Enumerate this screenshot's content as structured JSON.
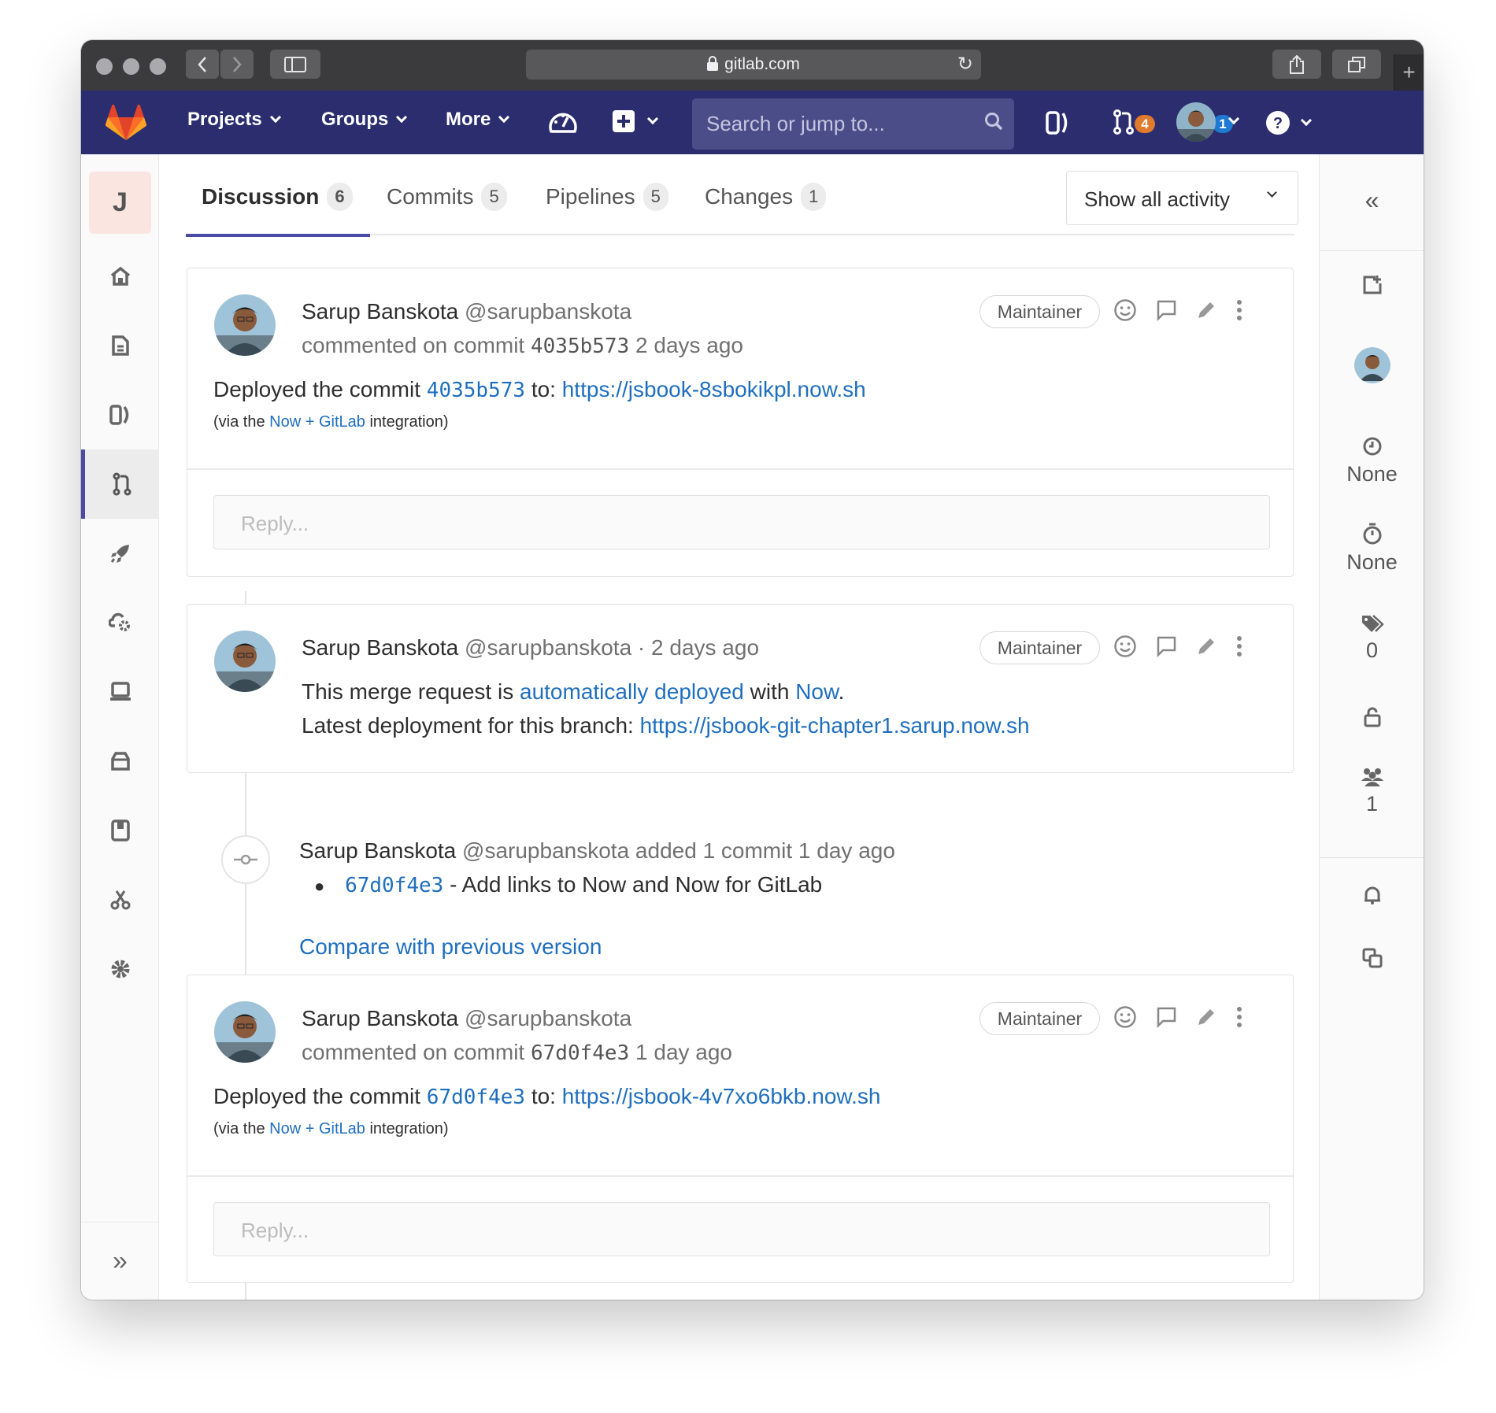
{
  "browser": {
    "url": "gitlab.com"
  },
  "navbar": {
    "projects": "Projects",
    "groups": "Groups",
    "more": "More",
    "search_placeholder": "Search or jump to...",
    "mr_count": "4",
    "todo_count": "1",
    "colors": {
      "navbar_bg": "#2b2d6e",
      "mr_badge": "#e07a2d",
      "todo_badge": "#1f78d1"
    }
  },
  "left_sidebar": {
    "project_initial": "J",
    "items": [
      {
        "icon": "home-icon"
      },
      {
        "icon": "document-icon"
      },
      {
        "icon": "issues-icon"
      },
      {
        "icon": "merge-request-icon",
        "active": true
      },
      {
        "icon": "rocket-icon"
      },
      {
        "icon": "operations-icon"
      },
      {
        "icon": "monitor-icon"
      },
      {
        "icon": "package-icon"
      },
      {
        "icon": "wiki-icon"
      },
      {
        "icon": "snippets-icon"
      },
      {
        "icon": "settings-icon"
      }
    ],
    "collapse": "»"
  },
  "tabs": [
    {
      "label": "Discussion",
      "count": "6",
      "active": true
    },
    {
      "label": "Commits",
      "count": "5"
    },
    {
      "label": "Pipelines",
      "count": "5"
    },
    {
      "label": "Changes",
      "count": "1"
    }
  ],
  "activity_filter": "Show all activity",
  "notes": [
    {
      "author": "Sarup Banskota",
      "handle": "@sarupbanskota",
      "meta_prefix": "commented on commit",
      "commit": "4035b573",
      "time": "2 days ago",
      "role": "Maintainer",
      "body_prefix": "Deployed the commit",
      "body_commit": "4035b573",
      "body_to": "to:",
      "body_url": "https://jsbook-8sbokikpl.now.sh",
      "via_prefix": "(via the",
      "via_link": "Now + GitLab",
      "via_suffix": "integration)",
      "reply_placeholder": "Reply..."
    },
    {
      "author": "Sarup Banskota",
      "handle": "@sarupbanskota",
      "time": "· 2 days ago",
      "role": "Maintainer",
      "line1_prefix": "This merge request is",
      "line1_link": "automatically deployed",
      "line1_mid": "with",
      "line1_link2": "Now",
      "line1_suffix": ".",
      "line2_prefix": "Latest deployment for this branch:",
      "line2_url": "https://jsbook-git-chapter1.sarup.now.sh"
    },
    {
      "author": "Sarup Banskota",
      "handle": "@sarupbanskota",
      "meta_prefix": "commented on commit",
      "commit": "67d0f4e3",
      "time": "1 day ago",
      "role": "Maintainer",
      "body_prefix": "Deployed the commit",
      "body_commit": "67d0f4e3",
      "body_to": "to:",
      "body_url": "https://jsbook-4v7xo6bkb.now.sh",
      "via_prefix": "(via the",
      "via_link": "Now + GitLab",
      "via_suffix": "integration)",
      "reply_placeholder": "Reply..."
    }
  ],
  "system_note": {
    "author": "Sarup Banskota",
    "handle": "@sarupbanskota",
    "action": "added 1 commit",
    "time": "1 day ago",
    "commit": "67d0f4e3",
    "commit_message": "- Add links to Now and Now for GitLab",
    "compare_link": "Compare with previous version"
  },
  "right_sidebar": {
    "collapse": "«",
    "milestone": "None",
    "time_tracking": "None",
    "labels": "0",
    "participants": "1"
  }
}
